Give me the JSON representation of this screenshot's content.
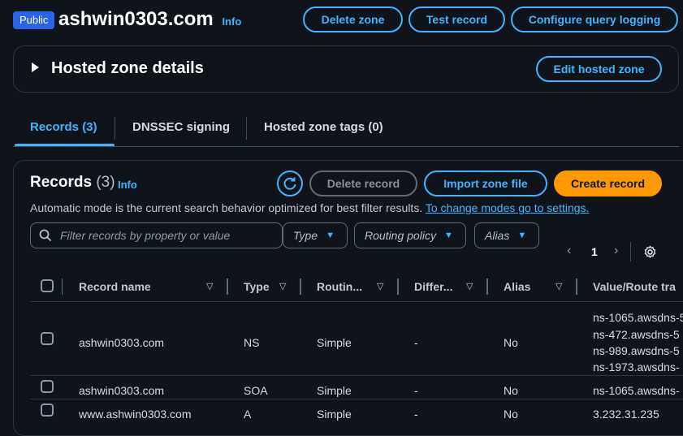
{
  "header": {
    "badge": "Public",
    "zone_name": "ashwin0303.com",
    "info": "Info",
    "buttons": {
      "delete_zone": "Delete zone",
      "test_record": "Test record",
      "configure_query_logging": "Configure query logging"
    }
  },
  "hosted_zone": {
    "title": "Hosted zone details",
    "edit_button": "Edit hosted zone"
  },
  "tabs": [
    {
      "label": "Records (3)",
      "active": true
    },
    {
      "label": "DNSSEC signing",
      "active": false
    },
    {
      "label": "Hosted zone tags (0)",
      "active": false
    }
  ],
  "records": {
    "heading": "Records",
    "count": "(3)",
    "info": "Info",
    "buttons": {
      "delete_record": "Delete record",
      "import_zone_file": "Import zone file",
      "create_record": "Create record"
    },
    "description": "Automatic mode is the current search behavior optimized for best filter results.",
    "description_link": "To change modes go to settings.",
    "search_placeholder": "Filter records by property or value",
    "filters": {
      "type": "Type",
      "routing_policy": "Routing policy",
      "alias": "Alias"
    },
    "pagination": {
      "page": "1"
    },
    "columns": [
      "Record name",
      "Type",
      "Routin...",
      "Differ...",
      "Alias",
      "Value/Route tra"
    ],
    "rows": [
      {
        "name": "ashwin0303.com",
        "type": "NS",
        "routing": "Simple",
        "differentiator": "-",
        "alias": "No",
        "values": [
          "ns-1065.awsdns-5",
          "ns-472.awsdns-5",
          "ns-989.awsdns-5",
          "ns-1973.awsdns-"
        ]
      },
      {
        "name": "ashwin0303.com",
        "type": "SOA",
        "routing": "Simple",
        "differentiator": "-",
        "alias": "No",
        "values": [
          "ns-1065.awsdns-"
        ]
      },
      {
        "name": "www.ashwin0303.com",
        "type": "A",
        "routing": "Simple",
        "differentiator": "-",
        "alias": "No",
        "values": [
          "3.232.31.235"
        ]
      }
    ]
  },
  "colors": {
    "background": "#0f141a",
    "accent": "#42b4ff",
    "primary": "#ff9900",
    "badge": "#2c64e8"
  }
}
